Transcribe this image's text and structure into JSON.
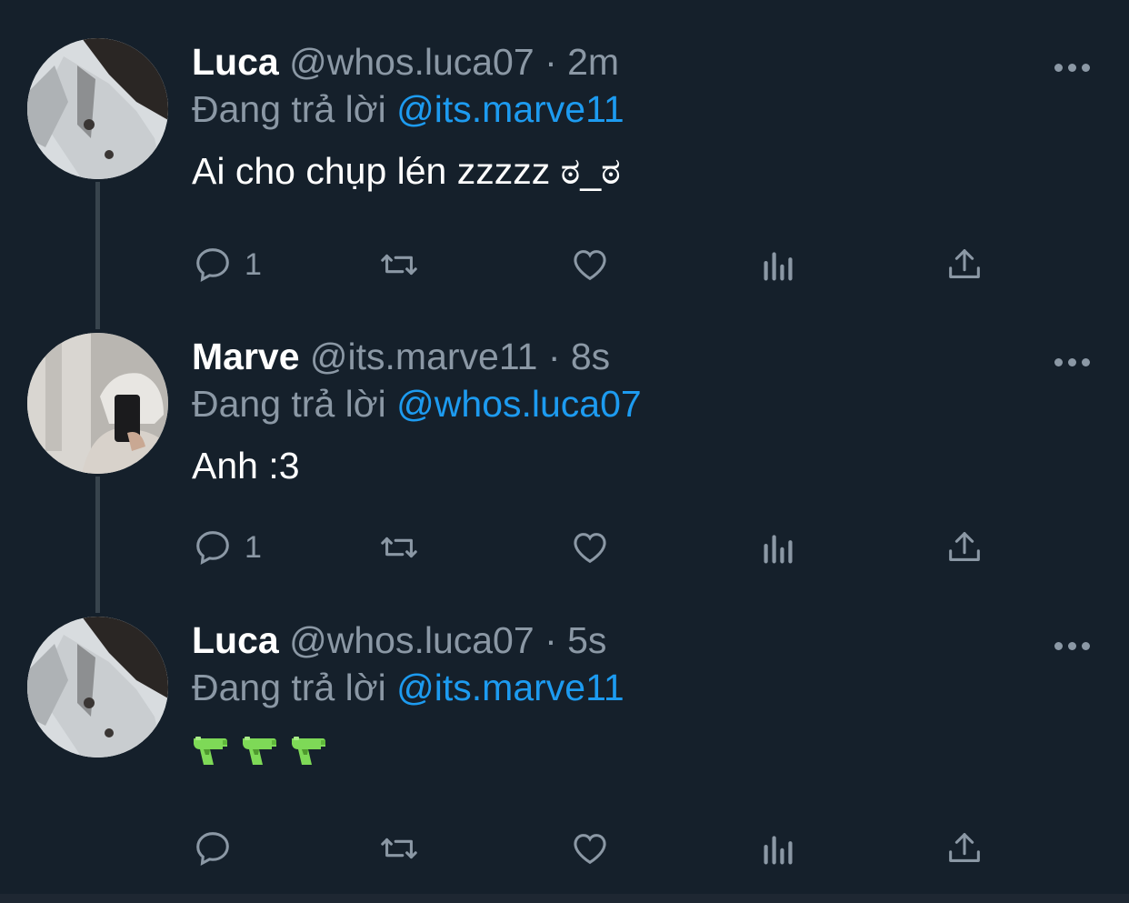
{
  "tweets": [
    {
      "name": "Luca",
      "handle": "@whos.luca07",
      "time": "2m",
      "reply_prefix": "Đang trả lời",
      "reply_to": "@its.marve11",
      "text": "Ai cho chụp lén zzzzz ಠ_ಠ",
      "reply_count": "1"
    },
    {
      "name": "Marve",
      "handle": "@its.marve11",
      "time": "8s",
      "reply_prefix": "Đang trả lời",
      "reply_to": "@whos.luca07",
      "text": "Anh :3",
      "reply_count": "1"
    },
    {
      "name": "Luca",
      "handle": "@whos.luca07",
      "time": "5s",
      "reply_prefix": "Đang trả lời",
      "reply_to": "@its.marve11",
      "emojis": [
        "water-pistol-emoji",
        "water-pistol-emoji",
        "water-pistol-emoji"
      ],
      "reply_count": ""
    }
  ],
  "separator": "·",
  "icons": {
    "reply": "reply-icon",
    "retweet": "retweet-icon",
    "like": "like-icon",
    "views": "views-icon",
    "share": "share-icon",
    "more": "more-icon"
  },
  "colors": {
    "background": "#15202b",
    "secondary_text": "#8b98a5",
    "link": "#1d9bf0",
    "thread_line": "#38444d"
  }
}
